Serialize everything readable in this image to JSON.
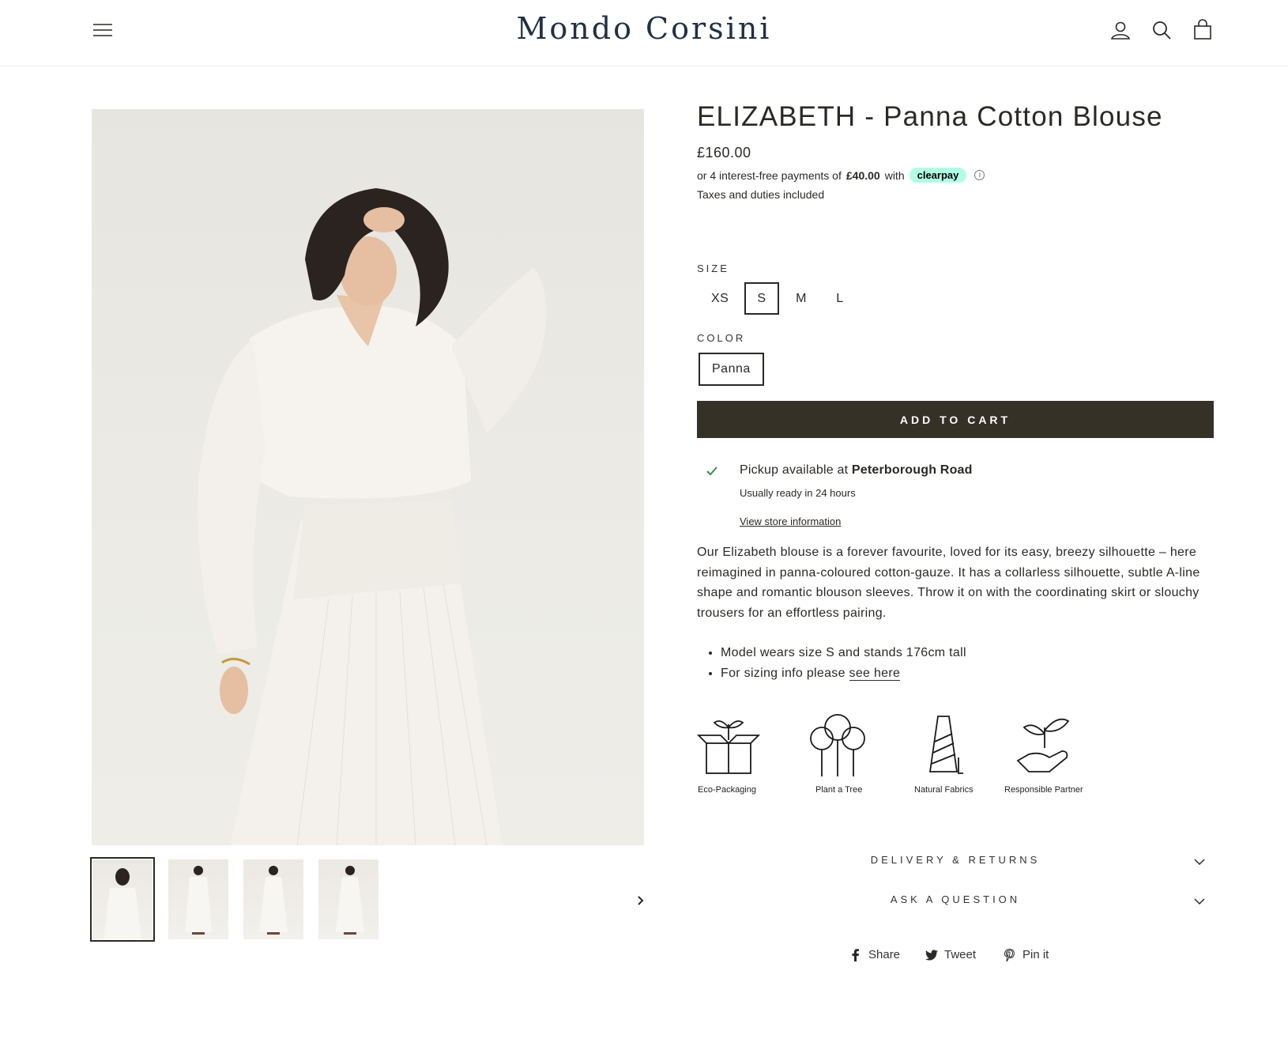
{
  "header": {
    "logo_text": "Mondo Corsini",
    "icons": [
      "menu-icon",
      "account-icon",
      "search-icon",
      "cart-icon"
    ]
  },
  "gallery": {
    "thumbnails_count": 4,
    "active_thumbnail": 1
  },
  "product": {
    "title": "ELIZABETH - Panna Cotton Blouse",
    "price": "£160.00",
    "clearpay": {
      "prefix": "or 4 interest-free payments of",
      "amount": "£40.00",
      "with": "with",
      "brand": "clearpay",
      "info": "i"
    },
    "taxes": "Taxes and duties included",
    "size_label": "SIZE",
    "sizes": [
      "XS",
      "S",
      "M",
      "L"
    ],
    "selected_size": "S",
    "color_label": "COLOR",
    "colors": [
      "Panna"
    ],
    "add_to_cart": "ADD TO CART",
    "pickup": {
      "prefix": "Pickup available at",
      "store": "Peterborough Road",
      "ready": "Usually ready in 24 hours",
      "link": "View store information"
    },
    "description": "Our Elizabeth blouse is a forever favourite, loved for its easy, breezy silhouette – here reimagined in panna-coloured cotton-gauze. It has a collarless silhouette, subtle A-line shape and romantic blouson sleeves. Throw it on with the coordinating skirt or slouchy trousers for an effortless pairing.",
    "bullets": {
      "model": "Model wears size S and stands 176cm tall",
      "sizing_prefix": "For sizing info please",
      "sizing_link": "see here"
    },
    "badges": [
      {
        "label": "Eco-Packaging",
        "icon": "eco-packaging-icon"
      },
      {
        "label": "Plant a Tree",
        "icon": "trees-icon"
      },
      {
        "label": "Natural Fabrics",
        "icon": "thread-spool-icon"
      },
      {
        "label": "Responsible Partner",
        "icon": "hand-plant-icon"
      }
    ],
    "accordions": [
      "DELIVERY & RETURNS",
      "ASK A QUESTION"
    ],
    "social": {
      "share": "Share",
      "tweet": "Tweet",
      "pin": "Pin it"
    }
  },
  "colors": {
    "logo": "#1f3142",
    "button_bg": "#353127",
    "check": "#3a8c4e",
    "clearpay_badge": "#b2fce4"
  }
}
